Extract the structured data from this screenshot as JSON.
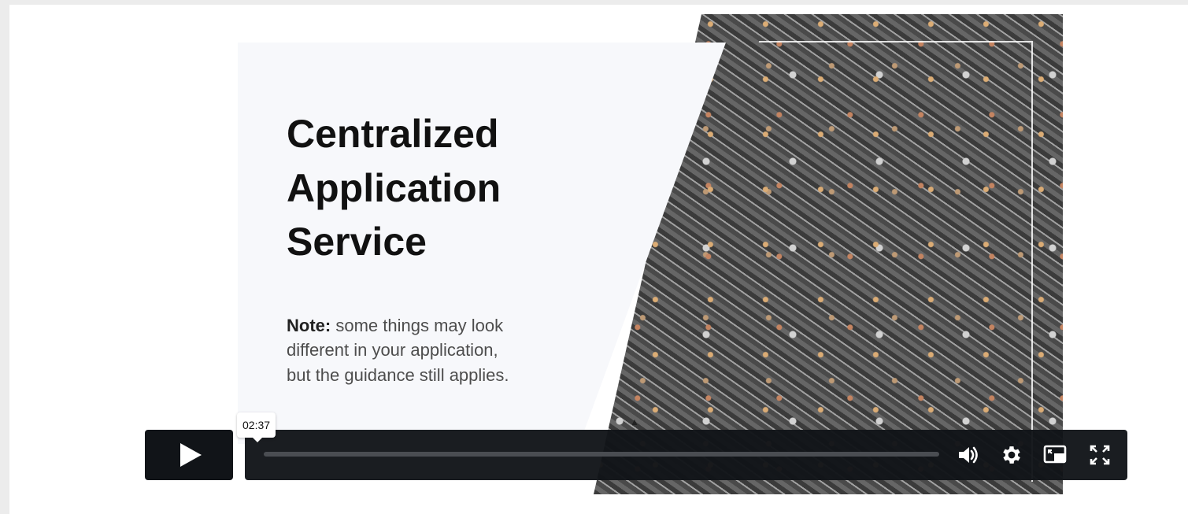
{
  "slide": {
    "title_lines": [
      "Centralized",
      "Application",
      "Service"
    ],
    "note_label": "Note:",
    "note_lines": [
      "some things may look",
      "different in your application,",
      "but the guidance still applies."
    ]
  },
  "player": {
    "time_tooltip": "02:37",
    "progress_fraction": 0.0,
    "icons": {
      "play": "play-icon",
      "volume": "volume-icon",
      "settings": "gear-icon",
      "pip": "picture-in-picture-icon",
      "fullscreen": "fullscreen-icon"
    }
  }
}
